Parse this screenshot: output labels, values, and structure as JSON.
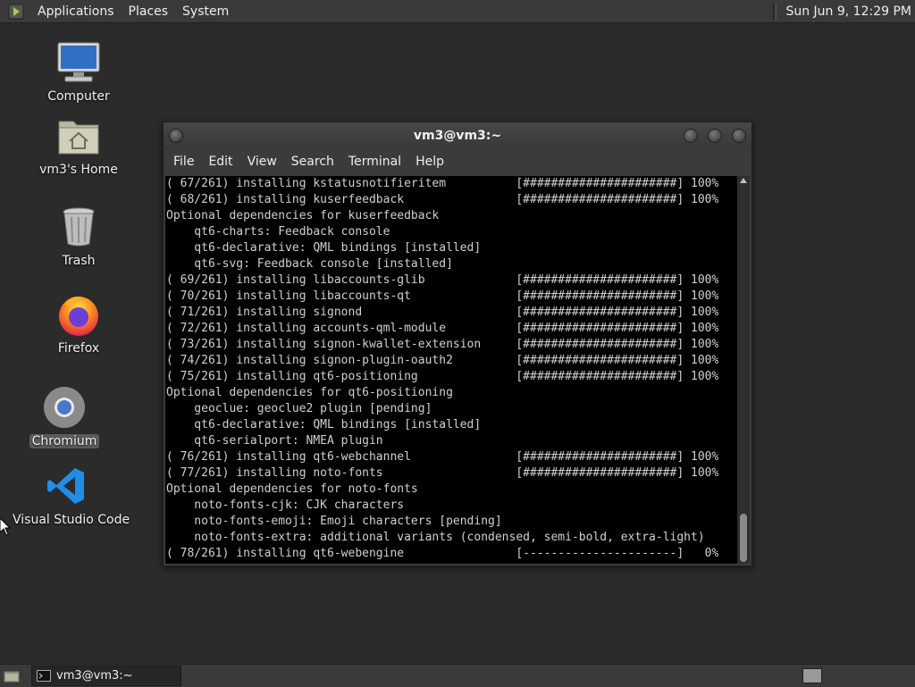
{
  "top_panel": {
    "menus": [
      "Applications",
      "Places",
      "System"
    ],
    "clock": "Sun Jun  9, 12:29 PM"
  },
  "desktop": {
    "icons": [
      {
        "label": "Computer",
        "icon": "computer-icon"
      },
      {
        "label": "vm3's Home",
        "icon": "home-folder-icon"
      },
      {
        "label": "Trash",
        "icon": "trash-icon"
      },
      {
        "label": "Firefox",
        "icon": "firefox-icon"
      },
      {
        "label": "Chromium",
        "icon": "chromium-icon",
        "selected": true
      },
      {
        "label": "Visual Studio Code",
        "icon": "vscode-icon"
      }
    ]
  },
  "terminal": {
    "title": "vm3@vm3:~",
    "menu": [
      "File",
      "Edit",
      "View",
      "Search",
      "Terminal",
      "Help"
    ],
    "lines": [
      "( 67/261) installing kstatusnotifieritem          [######################] 100%",
      "( 68/261) installing kuserfeedback                [######################] 100%",
      "Optional dependencies for kuserfeedback",
      "    qt6-charts: Feedback console",
      "    qt6-declarative: QML bindings [installed]",
      "    qt6-svg: Feedback console [installed]",
      "( 69/261) installing libaccounts-glib             [######################] 100%",
      "( 70/261) installing libaccounts-qt               [######################] 100%",
      "( 71/261) installing signond                      [######################] 100%",
      "( 72/261) installing accounts-qml-module          [######################] 100%",
      "( 73/261) installing signon-kwallet-extension     [######################] 100%",
      "( 74/261) installing signon-plugin-oauth2         [######################] 100%",
      "( 75/261) installing qt6-positioning              [######################] 100%",
      "Optional dependencies for qt6-positioning",
      "    geoclue: geoclue2 plugin [pending]",
      "    qt6-declarative: QML bindings [installed]",
      "    qt6-serialport: NMEA plugin",
      "( 76/261) installing qt6-webchannel               [######################] 100%",
      "( 77/261) installing noto-fonts                   [######################] 100%",
      "Optional dependencies for noto-fonts",
      "    noto-fonts-cjk: CJK characters",
      "    noto-fonts-emoji: Emoji characters [pending]",
      "    noto-fonts-extra: additional variants (condensed, semi-bold, extra-light)",
      "( 78/261) installing qt6-webengine                [----------------------]   0%"
    ]
  },
  "taskbar": {
    "tasks": [
      {
        "label": "vm3@vm3:~",
        "icon": "terminal-icon"
      }
    ]
  }
}
